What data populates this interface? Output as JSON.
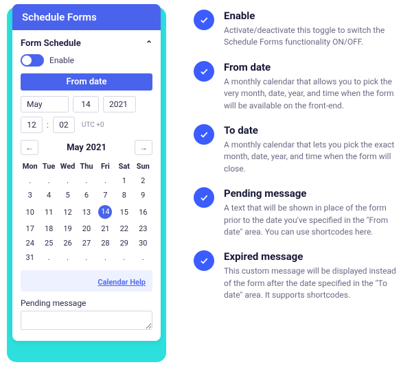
{
  "card": {
    "title": "Schedule Forms",
    "section": "Form Schedule",
    "toggle_label": "Enable",
    "from_date_bar": "From date",
    "month": "May",
    "day": "14",
    "year": "2021",
    "hour": "12",
    "minute": "02",
    "utc": "UTC +0",
    "cal_title": "May 2021",
    "dow": [
      "Mon",
      "Tue",
      "Wed",
      "Thu",
      "Fri",
      "Sat",
      "Sun"
    ],
    "weeks": [
      [
        "",
        "",
        "",
        "",
        "",
        "1",
        "2"
      ],
      [
        "3",
        "4",
        "5",
        "6",
        "7",
        "8",
        "9"
      ],
      [
        "10",
        "11",
        "12",
        "13",
        "14",
        "15",
        "16"
      ],
      [
        "17",
        "18",
        "19",
        "20",
        "21",
        "22",
        "23"
      ],
      [
        "24",
        "25",
        "26",
        "27",
        "28",
        "29",
        "30"
      ],
      [
        "31",
        "",
        "",
        "",
        "",
        "",
        ""
      ]
    ],
    "selected_day": "14",
    "help": "Calendar Help",
    "pending_label": "Pending message"
  },
  "features": [
    {
      "title": "Enable",
      "desc": "Activate/deactivate this toggle to switch the Schedule Forms functionality ON/OFF."
    },
    {
      "title": "From date",
      "desc": "A monthly calendar that allows you to pick the very month, date, year, and time when the form will be available on the front-end."
    },
    {
      "title": "To date",
      "desc": "A monthly calendar that lets you pick the exact month, date, year, and time when the form will close."
    },
    {
      "title": "Pending message",
      "desc": "A text that will be shown in place of the form prior to the date you've specified in the \"From date\" area. You can use shortcodes here."
    },
    {
      "title": "Expired message",
      "desc": "This custom message will be displayed instead of the form after the date specified in the \"To date\" area. It supports shortcodes."
    }
  ]
}
